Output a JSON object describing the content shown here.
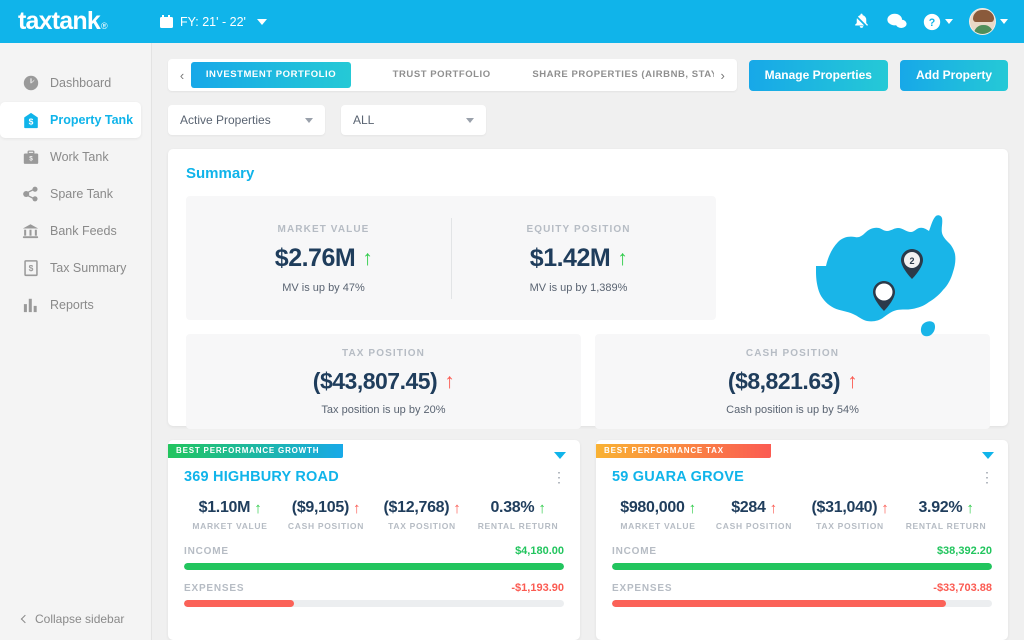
{
  "header": {
    "logo": "taxtank",
    "logo_mark": "®",
    "fy_label": "FY: 21' - 22'",
    "icons": {
      "notifications": "bell-muted-icon",
      "chat": "chat-bubbles-icon",
      "help": "help-circle-icon",
      "avatar": "user-avatar"
    }
  },
  "sidebar": {
    "items": [
      {
        "label": "Dashboard",
        "icon": "dashboard-icon",
        "active": false
      },
      {
        "label": "Property Tank",
        "icon": "property-tank-icon",
        "active": true
      },
      {
        "label": "Work Tank",
        "icon": "work-tank-icon",
        "active": false
      },
      {
        "label": "Spare Tank",
        "icon": "spare-tank-icon",
        "active": false
      },
      {
        "label": "Bank Feeds",
        "icon": "bank-feeds-icon",
        "active": false
      },
      {
        "label": "Tax Summary",
        "icon": "tax-summary-icon",
        "active": false
      },
      {
        "label": "Reports",
        "icon": "reports-icon",
        "active": false
      }
    ],
    "collapse_label": "Collapse sidebar"
  },
  "tabs": {
    "prev_arrow": "‹",
    "next_arrow": "›",
    "items": [
      {
        "label": "INVESTMENT PORTFOLIO",
        "active": true
      },
      {
        "label": "TRUST PORTFOLIO",
        "active": false
      },
      {
        "label": "SHARE PROPERTIES (AIRBNB, STAYZ, ETC)",
        "active": false
      }
    ]
  },
  "actions": {
    "manage_properties": "Manage Properties",
    "add_property": "Add Property"
  },
  "filters": {
    "status": "Active Properties",
    "type": "ALL"
  },
  "summary": {
    "title": "Summary",
    "tiles": [
      {
        "label": "MARKET VALUE",
        "value": "$2.76M",
        "arrow": "↑",
        "arrow_color": "green",
        "sub": "MV is up by 47%"
      },
      {
        "label": "EQUITY POSITION",
        "value": "$1.42M",
        "arrow": "↑",
        "arrow_color": "green",
        "sub": "MV is up by 1,389%"
      },
      {
        "label": "TAX POSITION",
        "value": "($43,807.45)",
        "arrow": "↑",
        "arrow_color": "red",
        "sub": "Tax position is up by 20%"
      },
      {
        "label": "CASH POSITION",
        "value": "($8,821.63)",
        "arrow": "↑",
        "arrow_color": "red",
        "sub": "Cash position is up by 54%"
      }
    ],
    "map": {
      "region": "Australia",
      "pin_count_label": "2",
      "markers": [
        {
          "label": "2",
          "style": "dark"
        },
        {
          "label": "",
          "style": "white"
        }
      ]
    }
  },
  "properties": [
    {
      "badge": "BEST PERFORMANCE GROWTH",
      "badge_style": "growth",
      "address": "369 HIGHBURY ROAD",
      "stats": [
        {
          "label": "MARKET VALUE",
          "value": "$1.10M",
          "arrow": "↑",
          "arrow_color": "green"
        },
        {
          "label": "CASH POSITION",
          "value": "($9,105)",
          "arrow": "↑",
          "arrow_color": "red"
        },
        {
          "label": "TAX POSITION",
          "value": "($12,768)",
          "arrow": "↑",
          "arrow_color": "red"
        },
        {
          "label": "RENTAL RETURN",
          "value": "0.38%",
          "arrow": "↑",
          "arrow_color": "green"
        }
      ],
      "income_label": "INCOME",
      "income_amount": "$4,180.00",
      "income_pct": 100,
      "expenses_label": "EXPENSES",
      "expenses_amount": "-$1,193.90",
      "expenses_pct": 29
    },
    {
      "badge": "BEST PERFORMANCE TAX",
      "badge_style": "tax",
      "address": "59 GUARA GROVE",
      "stats": [
        {
          "label": "MARKET VALUE",
          "value": "$980,000",
          "arrow": "↑",
          "arrow_color": "green"
        },
        {
          "label": "CASH POSITION",
          "value": "$284",
          "arrow": "↑",
          "arrow_color": "red"
        },
        {
          "label": "TAX POSITION",
          "value": "($31,040)",
          "arrow": "↑",
          "arrow_color": "red"
        },
        {
          "label": "RENTAL RETURN",
          "value": "3.92%",
          "arrow": "↑",
          "arrow_color": "green"
        }
      ],
      "income_label": "INCOME",
      "income_amount": "$38,392.20",
      "income_pct": 100,
      "expenses_label": "EXPENSES",
      "expenses_amount": "-$33,703.88",
      "expenses_pct": 88
    }
  ],
  "colors": {
    "brand": "#10b4ea",
    "gradient_start": "#17a8e8",
    "gradient_end": "#25c9d6",
    "positive": "#22c55e",
    "negative": "#fb5b52",
    "value_text": "#1f3d5c"
  }
}
